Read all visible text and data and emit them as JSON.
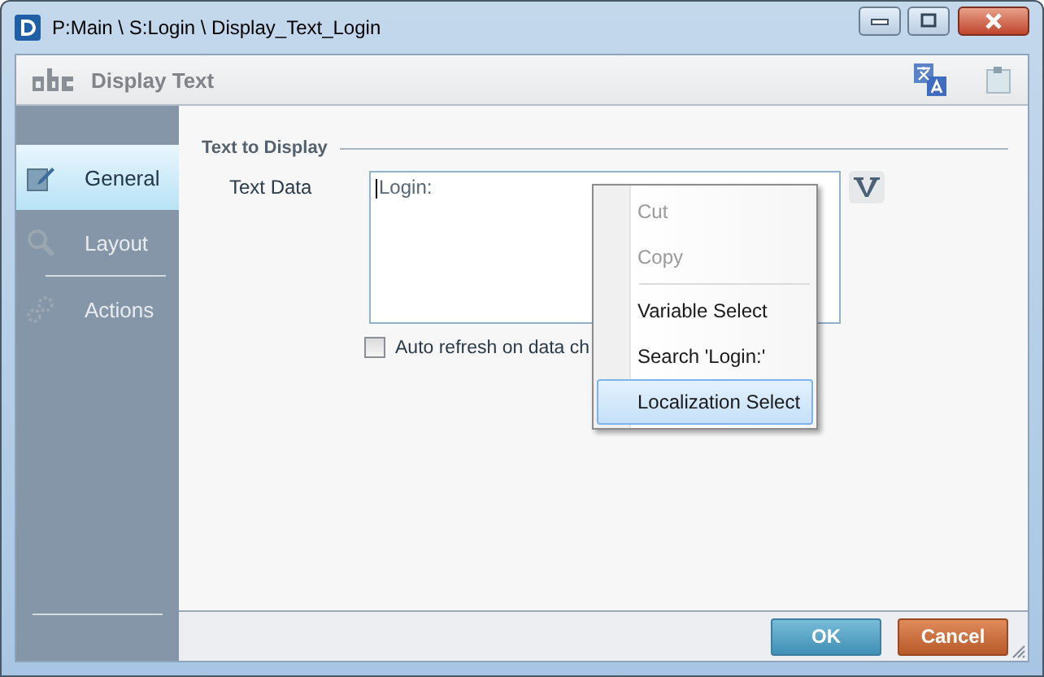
{
  "window": {
    "title": "P:Main \\ S:Login \\ Display_Text_Login"
  },
  "header": {
    "title": "Display Text"
  },
  "sidebar": {
    "items": [
      {
        "label": "General",
        "selected": true
      },
      {
        "label": "Layout",
        "selected": false
      },
      {
        "label": "Actions",
        "selected": false
      }
    ]
  },
  "group": {
    "title": "Text to Display"
  },
  "text_data": {
    "label": "Text Data",
    "value": "Login:"
  },
  "auto_refresh": {
    "label": "Auto refresh on data ch",
    "checked": false
  },
  "context_menu": {
    "groups": [
      [
        {
          "label": "Cut",
          "disabled": true,
          "selected": false
        },
        {
          "label": "Copy",
          "disabled": true,
          "selected": false
        }
      ],
      [
        {
          "label": "Variable Select",
          "disabled": false,
          "selected": false
        },
        {
          "label": "Search 'Login:'",
          "disabled": false,
          "selected": false
        },
        {
          "label": "Localization Select",
          "disabled": false,
          "selected": true
        }
      ]
    ]
  },
  "buttons": [
    {
      "label": "OK",
      "kind": "ok"
    },
    {
      "label": "Cancel",
      "kind": "cancel"
    }
  ]
}
